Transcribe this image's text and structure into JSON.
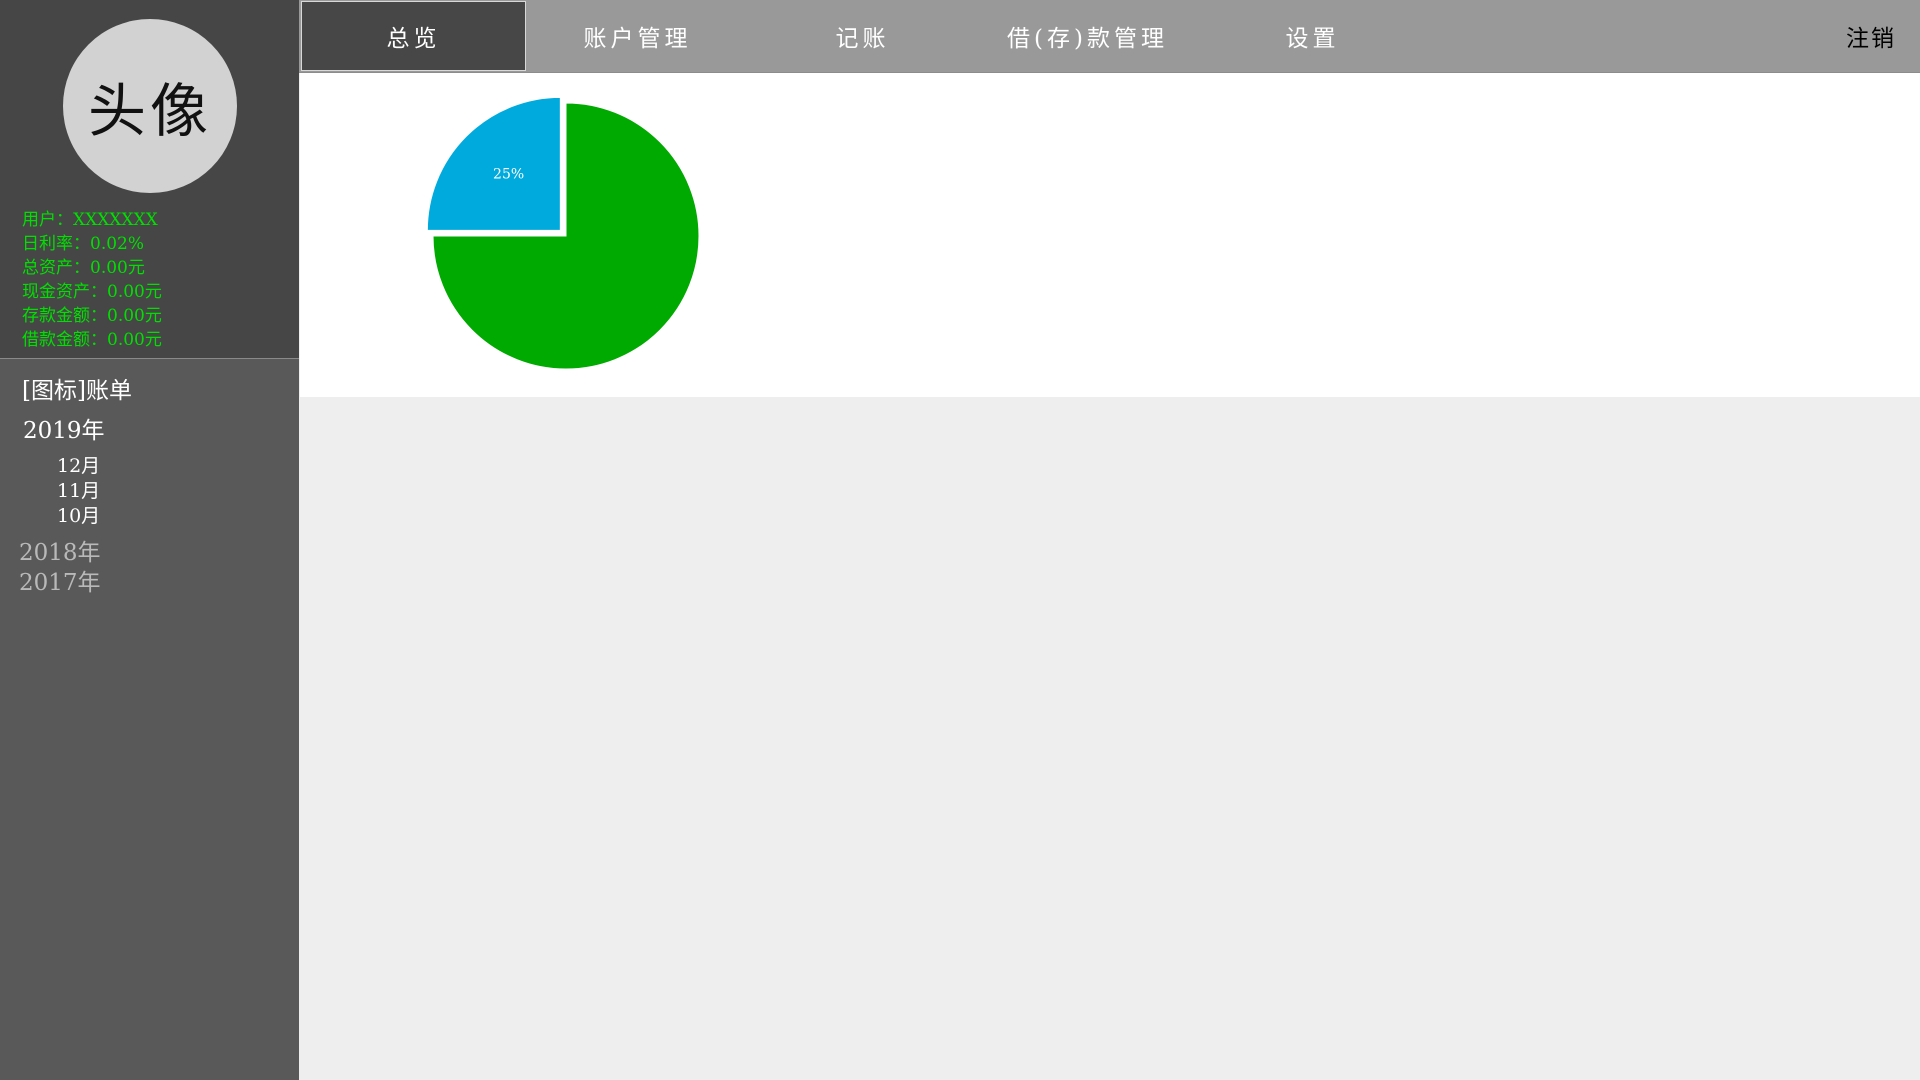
{
  "sidebar": {
    "avatar_label": "头像",
    "info": [
      "用户：XXXXXXX",
      "日利率：0.02%",
      "总资产：0.00元",
      "现金资产：0.00元",
      "存款金额：0.00元",
      "借款金额：0.00元"
    ],
    "bills_title": "[图标]账单",
    "active_year": "2019年",
    "months": [
      "12月",
      "11月",
      "10月"
    ],
    "other_years": [
      "2018年",
      "2017年"
    ]
  },
  "topnav": {
    "tabs": [
      "总览",
      "账户管理",
      "记账",
      "借(存)款管理",
      "设置"
    ],
    "active_tab": 0,
    "logout": "注销"
  },
  "colors": {
    "green": "#00aa00",
    "blue": "#00aadd",
    "info_text": "#00e000"
  },
  "chart_data": {
    "type": "pie",
    "slices": [
      {
        "value": 25,
        "color": "#00aadd",
        "label": "25%"
      },
      {
        "value": 75,
        "color": "#00aa00",
        "label": ""
      }
    ]
  }
}
